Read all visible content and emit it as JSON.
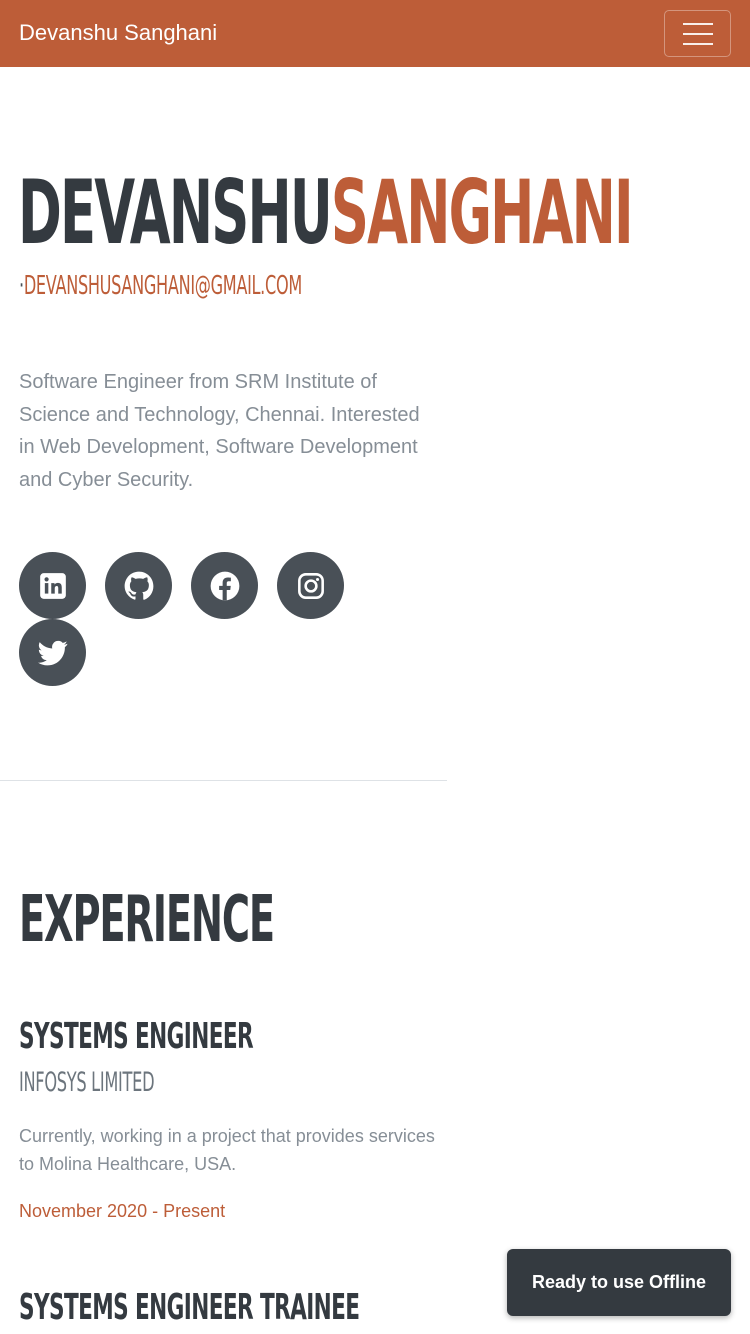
{
  "navbar": {
    "brand": "Devanshu Sanghani",
    "toggler_icon": "hamburger-menu-icon"
  },
  "hero": {
    "first_name": "DEVANSHU",
    "last_name": "SANGHANI",
    "separator": "·",
    "email": "DEVANSHUSANGHANI@GMAIL.COM",
    "bio": "Software Engineer from SRM Institute of Science and Technology, Chennai. Interested in Web Development, Software Development and Cyber Security.",
    "social": [
      {
        "icon": "linkedin-icon"
      },
      {
        "icon": "github-icon"
      },
      {
        "icon": "facebook-icon"
      },
      {
        "icon": "instagram-icon"
      },
      {
        "icon": "twitter-icon"
      }
    ]
  },
  "experience": {
    "heading": "EXPERIENCE",
    "jobs": [
      {
        "title": "SYSTEMS ENGINEER",
        "company": "INFOSYS LIMITED",
        "description": "Currently, working in a project that provides services to Molina Healthcare, USA.",
        "dates": "November 2020 - Present"
      },
      {
        "title": "SYSTEMS ENGINEER TRAINEE"
      }
    ]
  },
  "toast": {
    "message": "Ready to use Offline"
  },
  "colors": {
    "primary": "#bd5d38",
    "dark": "#343a40",
    "muted": "#868e96",
    "social_bg": "#495057"
  }
}
